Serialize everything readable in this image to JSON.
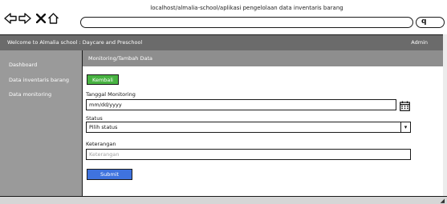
{
  "browser": {
    "url": "localhost/almalia-school/aplikasi pengelolaan data inventaris barang"
  },
  "header": {
    "welcome": "Welcome to Almalia school : Daycare and Preschool",
    "user": "Admin"
  },
  "sidebar": {
    "items": [
      {
        "label": "Dashboard"
      },
      {
        "label": "Data inventaris barang"
      },
      {
        "label": "Data monitoring"
      }
    ]
  },
  "main": {
    "breadcrumb": "Monitoring/Tambah Data",
    "back_label": "Kembali",
    "date_label": "Tanggal Monitoring",
    "date_value": "mm/dd/yyyy",
    "status_label": "Status",
    "status_value": "Pilih status",
    "notes_label": "Keterangan",
    "notes_placeholder": "Keterangan",
    "submit_label": "Submit"
  },
  "colors": {
    "header_bg": "#6b6b6b",
    "sidebar_bg": "#9a9a9a",
    "back_button": "#48b342",
    "submit_button": "#3f73de"
  }
}
